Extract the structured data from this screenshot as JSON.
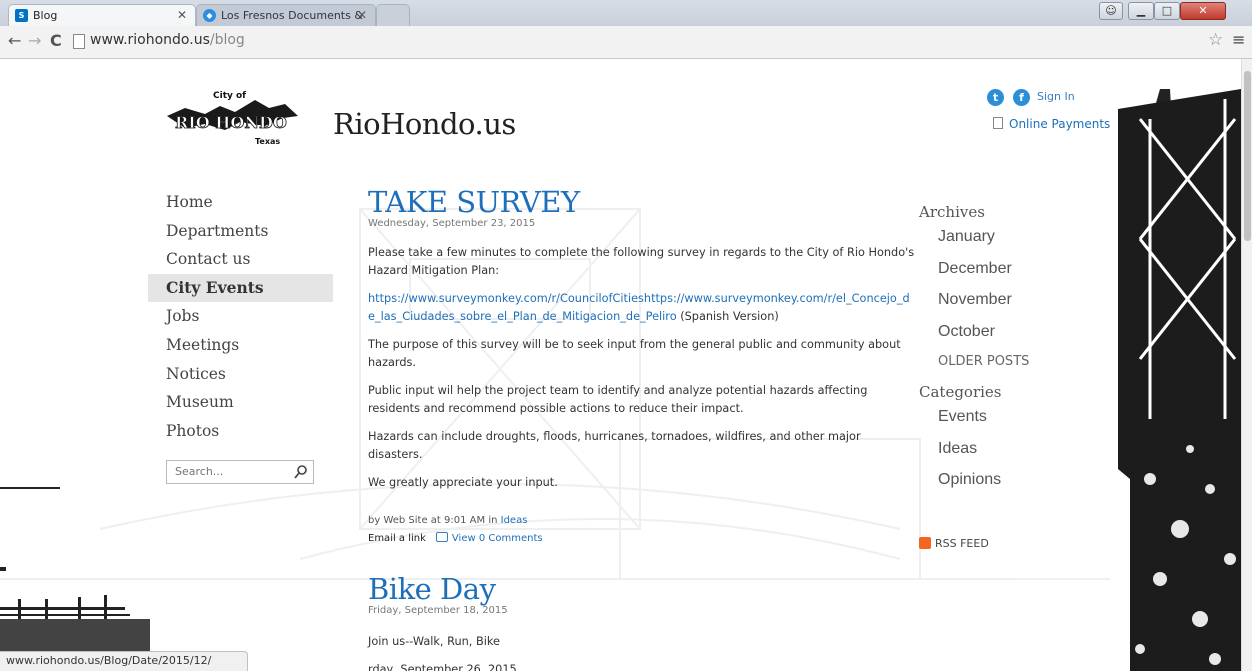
{
  "browser": {
    "tabs": [
      {
        "label": "Blog",
        "favicon": "S"
      },
      {
        "label": "Los Fresnos Documents &",
        "favicon": "◆"
      },
      {
        "label": ""
      }
    ],
    "url_domain": "www.riohondo.us",
    "url_path": "/blog",
    "status_url": "www.riohondo.us/Blog/Date/2015/12/"
  },
  "header": {
    "site_title": "RioHondo.us",
    "logo": {
      "city_of": "City of",
      "name": "RIO HONDO",
      "state": "Texas"
    },
    "sign_in": "Sign In",
    "online_payments": "Online Payments"
  },
  "nav": {
    "items": [
      {
        "label": "Home"
      },
      {
        "label": "Departments"
      },
      {
        "label": "Contact us"
      },
      {
        "label": "City Events",
        "active": true
      },
      {
        "label": "Jobs"
      },
      {
        "label": "Meetings"
      },
      {
        "label": "Notices"
      },
      {
        "label": "Museum"
      },
      {
        "label": "Photos"
      }
    ],
    "search_placeholder": "Search..."
  },
  "posts": [
    {
      "title": "TAKE SURVEY",
      "date": "Wednesday, September 23, 2015",
      "p1": "Please take a few minutes to complete the following survey in regards to the City of Rio Hondo's Hazard Mitigation Plan:",
      "link": "https://www.surveymonkey.com/r/CouncilofCitieshttps://www.surveymonkey.com/r/el_Concejo_de_las_Ciudades_sobre_el_Plan_de_Mitigacion_de_Peliro",
      "link_suffix": " (Spanish Version)",
      "p3": "The purpose of this survey will be to seek input from the general public and community about hazards.",
      "p4": "Public input wil help the project team to identify and analyze potential hazards affecting residents and recommend possible actions to reduce their impact.",
      "p5": "Hazards can include droughts, floods, hurricanes, tornadoes, wildfires, and other major disasters.",
      "p6": "We greatly appreciate your input.",
      "byline": "by Web Site at 9:01 AM in",
      "category": "Ideas",
      "email_link": "Email a link",
      "comments": "View 0 Comments"
    },
    {
      "title": "Bike Day",
      "date": "Friday, September 18, 2015",
      "p1": "Join us--Walk, Run, Bike",
      "p2": "rday, September 26, 2015"
    }
  ],
  "sidebar": {
    "archives_heading": "Archives",
    "archives": [
      "January",
      "December",
      "November",
      "October"
    ],
    "older_posts": "OLDER POSTS",
    "categories_heading": "Categories",
    "categories": [
      "Events",
      "Ideas",
      "Opinions"
    ],
    "rss": "RSS FEED"
  },
  "colors": {
    "link": "#1e6fb9",
    "title": "#1e6fb9"
  }
}
